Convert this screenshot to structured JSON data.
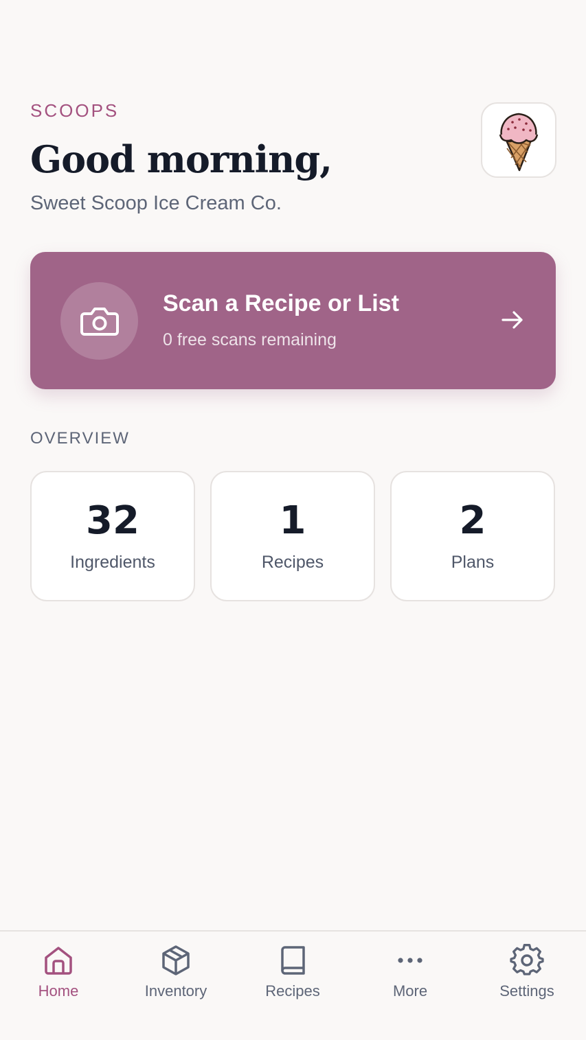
{
  "header": {
    "eyebrow": "SCOOPS",
    "greeting": "Good morning,",
    "business_name": "Sweet Scoop Ice Cream Co.",
    "logo_icon": "ice-cream-cone-icon"
  },
  "scan_card": {
    "title": "Scan a Recipe or List",
    "subtitle": "0 free scans remaining",
    "icon": "camera-icon",
    "action_icon": "arrow-right-icon",
    "color": "#a06488"
  },
  "overview": {
    "label": "OVERVIEW",
    "stats": [
      {
        "value": "32",
        "label": "Ingredients"
      },
      {
        "value": "1",
        "label": "Recipes"
      },
      {
        "value": "2",
        "label": "Plans"
      }
    ]
  },
  "tabbar": {
    "active": "Home",
    "accent_color": "#a3517f",
    "tabs": [
      {
        "label": "Home",
        "icon": "home-icon"
      },
      {
        "label": "Inventory",
        "icon": "box-icon"
      },
      {
        "label": "Recipes",
        "icon": "book-icon"
      },
      {
        "label": "More",
        "icon": "more-dots-icon"
      },
      {
        "label": "Settings",
        "icon": "gear-icon"
      }
    ]
  }
}
